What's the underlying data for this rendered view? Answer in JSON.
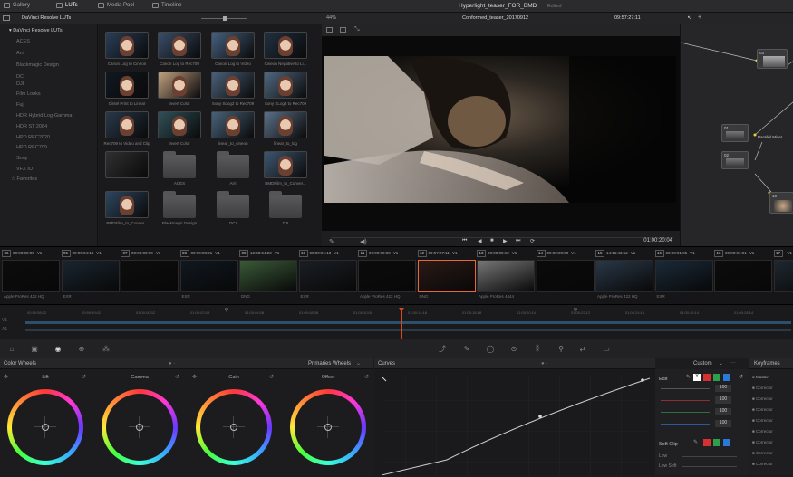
{
  "topbar": {
    "tabs": [
      "Gallery",
      "LUTs",
      "Media Pool",
      "Timeline"
    ],
    "project_title": "Hyperlight_teaser_FOR_BMD",
    "status": "Edited"
  },
  "subbar": {
    "lut_root": "DaVinci Resolve LUTs",
    "zoom": "44%",
    "timeline_name": "Conformed_teaser_20170912",
    "timecode": "09:57:27:11"
  },
  "lut_categories": [
    "ACES",
    "Arri",
    "Blackmagic Design",
    "DCI",
    "DJI",
    "Film Looks",
    "Fuji",
    "HDR Hybrid Log-Gamma",
    "HDR ST 2084",
    "HPD REC2020",
    "HPD REC709",
    "Sony",
    "VFX IO",
    "Favorites"
  ],
  "lut_thumbs": [
    {
      "label": "Canon Log to Cineon",
      "tint": "#2a3e58"
    },
    {
      "label": "Canon Log to Rec709",
      "tint": "#3a4e68"
    },
    {
      "label": "Canon Log to Video",
      "tint": "#456080"
    },
    {
      "label": "Cineon Negative to Li...",
      "tint": "#203040"
    },
    {
      "label": "Cintel Print to Linear",
      "tint": "#101820"
    },
    {
      "label": "Invert Color",
      "tint": "#c0a080"
    },
    {
      "label": "Sony SLog2 to Rec709",
      "tint": "#4a6078"
    },
    {
      "label": "Sony SLog3 to Rec709",
      "tint": "#506880"
    },
    {
      "label": "Rec709 to Video and Clip",
      "tint": "#28384a"
    },
    {
      "label": "Invert Color",
      "tint": "#305058"
    },
    {
      "label": "linear_to_cineon",
      "tint": "#486278"
    },
    {
      "label": "linear_to_log",
      "tint": "#5a7088"
    },
    {
      "label": "",
      "tint": "#303030"
    },
    {
      "label": "ACES",
      "tint": "folder"
    },
    {
      "label": "Arri",
      "tint": "folder"
    },
    {
      "label": "BMDFilm_to_Conver...",
      "tint": "#3e5670"
    },
    {
      "label": "BMDFilm_to_Conver...",
      "tint": "#2e465e"
    },
    {
      "label": "Blackmagic Design",
      "tint": "folder"
    },
    {
      "label": "DCI",
      "tint": "folder"
    },
    {
      "label": "DJI",
      "tint": "folder"
    }
  ],
  "viewer": {
    "timecode": "01:00:20:04"
  },
  "nodes": [
    {
      "num": "03",
      "label": ""
    },
    {
      "num": "01",
      "label": "Parallel Mixer"
    },
    {
      "num": "02",
      "label": ""
    },
    {
      "num": "10",
      "label": ""
    }
  ],
  "clips": [
    {
      "num": "06",
      "tc": "00:00:00:00",
      "track": "V1",
      "codec": "Apple ProRes 422 HQ",
      "tone": "#0c0c0c"
    },
    {
      "num": "06",
      "tc": "00:00:04:14",
      "track": "V1",
      "codec": "EXR",
      "tone": "#1a2530"
    },
    {
      "num": "07",
      "tc": "00:00:00:00",
      "track": "V1",
      "codec": "",
      "tone": "#0d0d0d"
    },
    {
      "num": "08",
      "tc": "00:00:00:21",
      "track": "V1",
      "codec": "EXR",
      "tone": "#101820"
    },
    {
      "num": "09",
      "tc": "12:48:54:20",
      "track": "V1",
      "codec": "DNG",
      "tone": "#3a5a38"
    },
    {
      "num": "10",
      "tc": "00:00:01:13",
      "track": "V1",
      "codec": "EXR",
      "tone": "#1a1e24"
    },
    {
      "num": "11",
      "tc": "00:00:00:00",
      "track": "V1",
      "codec": "Apple ProRes 422 HQ",
      "tone": "#0b0b0b"
    },
    {
      "num": "12",
      "tc": "09:57:27:11",
      "track": "V1",
      "codec": "DNG",
      "tone": "#2a1a16"
    },
    {
      "num": "13",
      "tc": "00:00:00:19",
      "track": "V1",
      "codec": "Apple ProRes 4444",
      "tone": "#777777"
    },
    {
      "num": "14",
      "tc": "00:00:00:00",
      "track": "V1",
      "codec": "",
      "tone": "#0a0a0a"
    },
    {
      "num": "15",
      "tc": "14:16:43:12",
      "track": "V1",
      "codec": "Apple ProRes 422 HQ",
      "tone": "#2a3848"
    },
    {
      "num": "16",
      "tc": "00:00:01:05",
      "track": "V1",
      "codec": "EXR",
      "tone": "#1a2a38"
    },
    {
      "num": "16",
      "tc": "00:00:01:01",
      "track": "V1",
      "codec": "",
      "tone": "#0c0c0c"
    },
    {
      "num": "17",
      "tc": "",
      "track": "V1",
      "codec": "",
      "tone": "#1e2830"
    }
  ],
  "mini_timeline_marks": [
    "00:59:58:02",
    "00:59:59:02",
    "01:00:00:02",
    "01:00:02:08",
    "01:00:04:08",
    "01:00:08:08",
    "01:00:10:08",
    "01:00:14:18",
    "01:00:18:18",
    "01:00:20:14",
    "01:00:22:12",
    "01:00:24:16",
    "01:00:26:14",
    "01:00:28:14"
  ],
  "track_labels": [
    "V1",
    "A1"
  ],
  "color_wheels": {
    "title": "Color Wheels",
    "mode": "Primaries Wheels",
    "wheels": [
      "Lift",
      "Gamma",
      "Gain",
      "Offset"
    ]
  },
  "curves": {
    "title": "Curves",
    "mode": "Custom"
  },
  "curve_side": {
    "edit_label": "Edit",
    "values": [
      "100",
      "100",
      "100",
      "100"
    ],
    "soft_clip": "Soft Clip",
    "low": "Low",
    "low_soft": "Low Soft"
  },
  "keyframes": {
    "title": "Keyframes",
    "rows": [
      "Master",
      "Corrector",
      "Corrector",
      "Corrector",
      "Corrector",
      "Corrector",
      "Corrector",
      "Corrector",
      "Corrector"
    ]
  },
  "colors": {
    "accent": "#e8673a",
    "playhead": "#d84a1e",
    "red": "#d63030",
    "green": "#2ea04a",
    "blue": "#2a78d8"
  }
}
